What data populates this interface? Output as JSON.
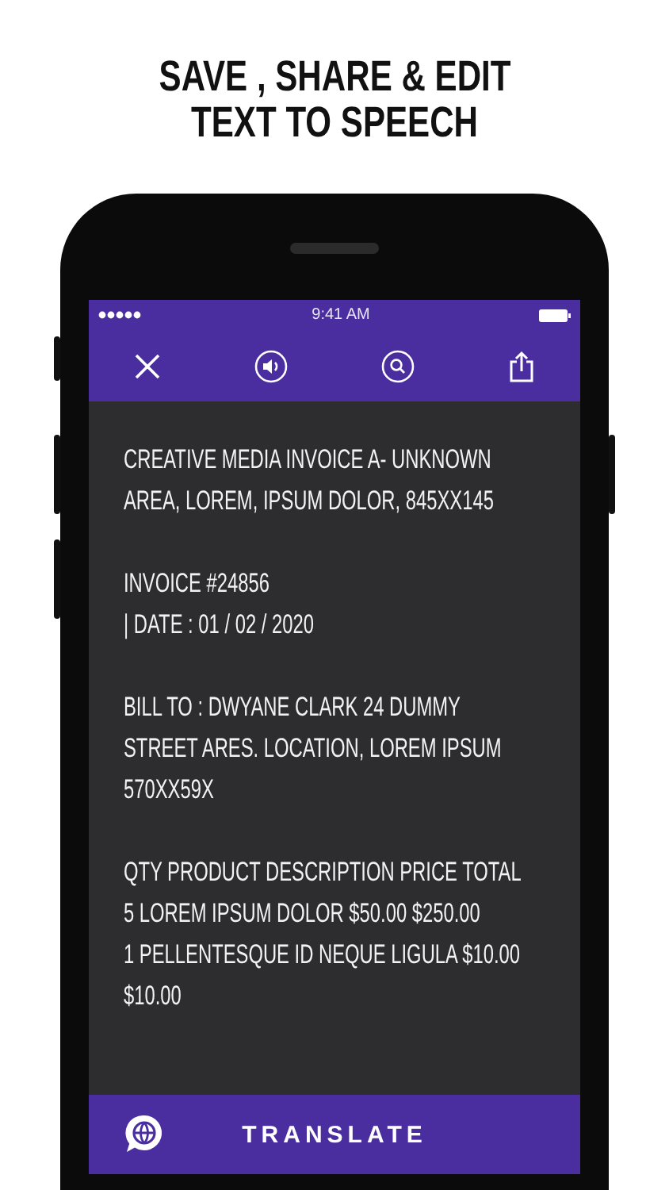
{
  "headline": [
    "SAVE , SHARE & EDIT",
    "TEXT TO SPEECH"
  ],
  "status_bar": {
    "time": "9:41 AM"
  },
  "toolbar": [
    {
      "kind": "close"
    },
    {
      "kind": "speaker"
    },
    {
      "kind": "search"
    },
    {
      "kind": "share"
    }
  ],
  "document": [
    "CREATIVE MEDIA INVOICE A- UNKNOWN\nAREA, LOREM, IPSUM DOLOR, 845XX145",
    "INVOICE #24856\n| DATE : 01 / 02 / 2020",
    "BILL TO : DWYANE CLARK 24 DUMMY\nSTREET ARES. LOCATION, LOREM IPSUM\n570XX59X",
    "QTY PRODUCT DESCRIPTION PRICE TOTAL\n5 LOREM IPSUM DOLOR $50.00 $250.00\n1 PELLENTESQUE ID NEQUE LIGULA $10.00\n$10.00"
  ],
  "translate_button": {
    "label": "TRANSLATE"
  }
}
